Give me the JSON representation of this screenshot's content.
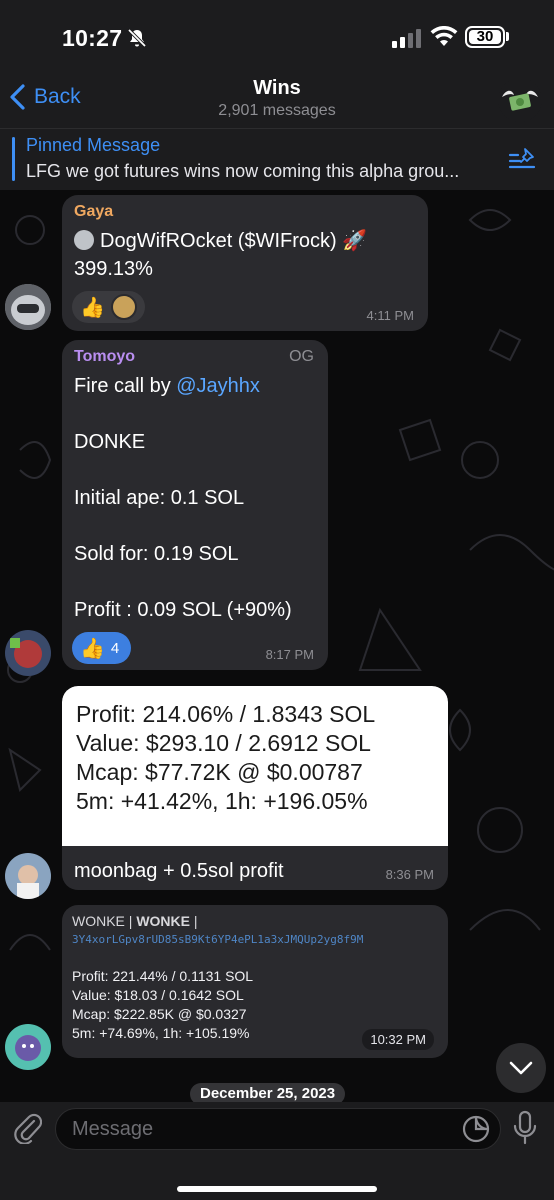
{
  "status_bar": {
    "time": "10:27",
    "battery": "30"
  },
  "header": {
    "back_label": "Back",
    "title": "Wins",
    "subtitle": "2,901 messages"
  },
  "pinned": {
    "label": "Pinned Message",
    "text": "LFG we got futures wins now coming this alpha grou..."
  },
  "messages": {
    "m1": {
      "sender": "Gaya",
      "sender_color": "#f0a860",
      "line1": "DogWifROcket ($WIFrock) 🚀",
      "line2": "399.13%",
      "reaction_emoji": "👍",
      "time": "4:11 PM"
    },
    "m2": {
      "sender": "Tomoyo",
      "sender_color": "#b98ef0",
      "badge": "OG",
      "line1_prefix": "Fire call by ",
      "line1_mention": "@Jayhhx",
      "line2": "DONKE",
      "line3": "Initial ape: 0.1 SOL",
      "line4": "Sold for: 0.19 SOL",
      "line5": "Profit : 0.09 SOL (+90%)",
      "reaction_emoji": "👍",
      "reaction_count": "4",
      "time": "8:17 PM"
    },
    "m3": {
      "image_lines": [
        "Profit: 214.06% / 1.8343 SOL",
        "Value: $293.10 / 2.6912 SOL",
        "Mcap: $77.72K @ $0.00787",
        "5m: +41.42%, 1h: +196.05%"
      ],
      "caption": "moonbag + 0.5sol profit",
      "time": "8:36 PM"
    },
    "m4": {
      "header_a": "WONKE | ",
      "header_b": "WONKE",
      "header_c": " |",
      "address": "3Y4xorLGpv8rUD85sB9Kt6YP4ePL1a3xJMQUp2yg8f9M",
      "profit": "Profit: 221.44% / 0.1131 SOL",
      "value": "Value: $18.03 / 0.1642 SOL",
      "mcap": "Mcap: $222.85K @ $0.0327",
      "change": "5m: +74.69%, 1h: +105.19%",
      "time": "10:32 PM"
    }
  },
  "date_separator": "December 25, 2023",
  "input": {
    "placeholder": "Message"
  },
  "colors": {
    "accent": "#3e8ff5",
    "bubble": "#2a2a2e",
    "background": "#0b0b0c"
  }
}
